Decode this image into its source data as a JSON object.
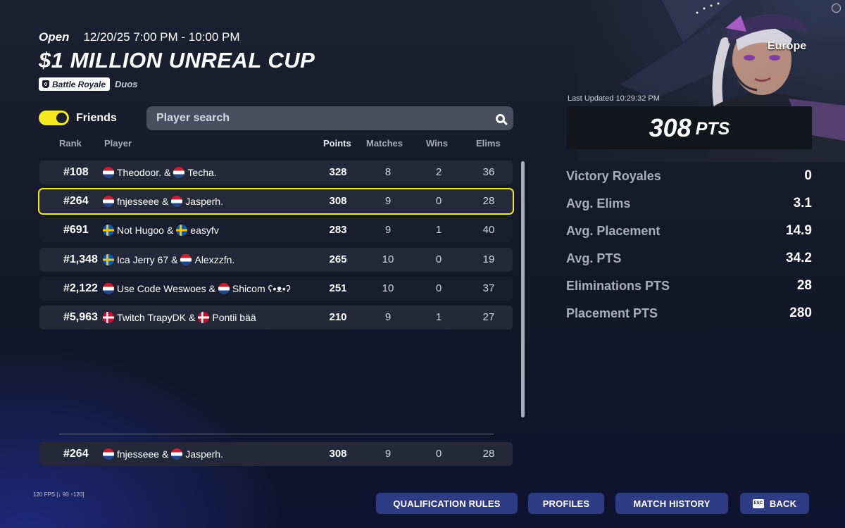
{
  "event": {
    "status": "Open",
    "datetime": "12/20/25 7:00 PM - 10:00 PM",
    "title": "$1 MILLION UNREAL CUP",
    "mode": "Battle Royale",
    "mode_icon": "money-bag-icon",
    "team_size": "Duos"
  },
  "filters": {
    "friends_label": "Friends",
    "friends_on": true,
    "search_placeholder": "Player search"
  },
  "columns": {
    "rank": "Rank",
    "player": "Player",
    "points": "Points",
    "matches": "Matches",
    "wins": "Wins",
    "elims": "Elims"
  },
  "rows": [
    {
      "rank": "#108",
      "p1_flag": "nl",
      "p1": "Theodoor.",
      "sep": "&",
      "p2_flag": "nl",
      "p2": "Techa.",
      "points": "328",
      "matches": "8",
      "wins": "2",
      "elims": "36"
    },
    {
      "rank": "#264",
      "p1_flag": "nl",
      "p1": "fnjesseee",
      "sep": "&",
      "p2_flag": "nl",
      "p2": "Jasperh.",
      "points": "308",
      "matches": "9",
      "wins": "0",
      "elims": "28"
    },
    {
      "rank": "#691",
      "p1_flag": "se",
      "p1": "Not Hugoo",
      "sep": "&",
      "p2_flag": "se",
      "p2": "easyfv",
      "points": "283",
      "matches": "9",
      "wins": "1",
      "elims": "40"
    },
    {
      "rank": "#1,348",
      "p1_flag": "se",
      "p1": "Ica Jerry 67",
      "sep": "&",
      "p2_flag": "nl",
      "p2": "Alexzzfn.",
      "points": "265",
      "matches": "10",
      "wins": "0",
      "elims": "19"
    },
    {
      "rank": "#2,122",
      "p1_flag": "nl",
      "p1": "Use Code Weswoes",
      "sep": "&",
      "p2_flag": "nl",
      "p2": "Shicom ʕ•ᴥ•ʔ",
      "points": "251",
      "matches": "10",
      "wins": "0",
      "elims": "37"
    },
    {
      "rank": "#5,963",
      "p1_flag": "dk",
      "p1": "Twitch TrapyDK",
      "sep": "&",
      "p2_flag": "dk",
      "p2": "Pontii bää",
      "points": "210",
      "matches": "9",
      "wins": "1",
      "elims": "27"
    }
  ],
  "my_row": {
    "rank": "#264",
    "p1_flag": "nl",
    "p1": "fnjesseee",
    "sep": "&",
    "p2_flag": "nl",
    "p2": "Jasperh.",
    "points": "308",
    "matches": "9",
    "wins": "0",
    "elims": "28"
  },
  "summary": {
    "region": "Europe",
    "last_updated": "Last Updated 10:29:32 PM",
    "points": "308",
    "points_unit": "PTS",
    "stats": [
      {
        "label": "Victory Royales",
        "value": "0"
      },
      {
        "label": "Avg. Elims",
        "value": "3.1"
      },
      {
        "label": "Avg. Placement",
        "value": "14.9"
      },
      {
        "label": "Avg. PTS",
        "value": "34.2"
      },
      {
        "label": "Eliminations PTS",
        "value": "28"
      },
      {
        "label": "Placement PTS",
        "value": "280"
      }
    ]
  },
  "footer": {
    "fps": "120 FPS [↓ 90 ↑120]",
    "buttons": {
      "qualification_rules": "QUALIFICATION RULES",
      "profiles": "PROFILES",
      "match_history": "MATCH HISTORY",
      "back": "BACK",
      "back_key": "ESC"
    }
  },
  "colors": {
    "highlight": "#f1ea2a",
    "toggle_on": "#f5ea1d",
    "button": "#2e3b85"
  }
}
